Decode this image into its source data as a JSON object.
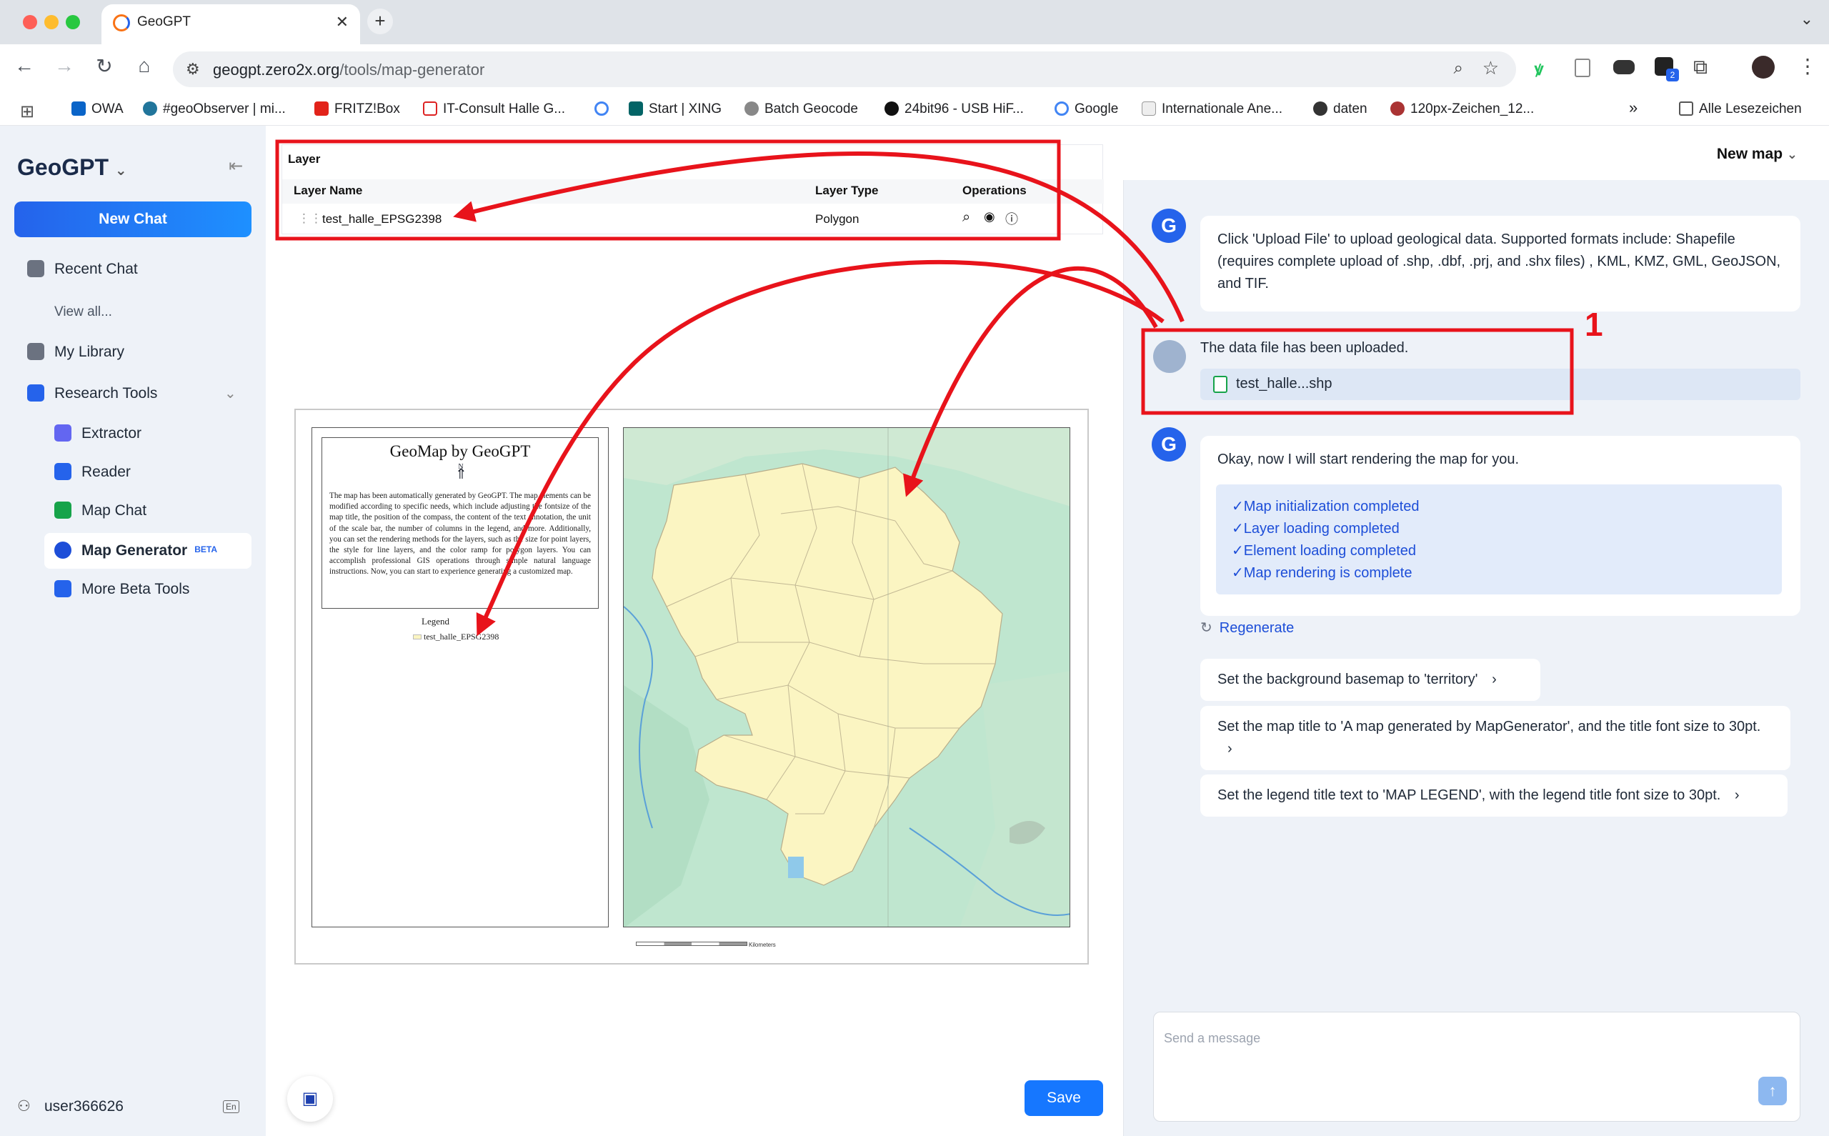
{
  "browser": {
    "tab_title": "GeoGPT",
    "url_host": "geogpt.zero2x.org",
    "url_path": "/tools/map-generator",
    "bookmarks": [
      "OWA",
      "#geoObserver | mi...",
      "FRITZ!Box",
      "IT-Consult Halle G...",
      "Start | XING",
      "Batch Geocode",
      "24bit96 - USB HiF...",
      "Google",
      "Internationale Ane...",
      "daten",
      "120px-Zeichen_12..."
    ],
    "all_bookmarks": "Alle Lesezeichen",
    "ext_badge": "2"
  },
  "sidebar": {
    "brand": "GeoGPT",
    "new_chat": "New Chat",
    "recent_chat": "Recent Chat",
    "view_all": "View all...",
    "my_library": "My Library",
    "research_tools": "Research Tools",
    "tools": [
      "Extractor",
      "Reader",
      "Map Chat",
      "Map Generator",
      "More Beta Tools"
    ],
    "beta_badge": "BETA",
    "user": "user366626",
    "lang": "En"
  },
  "layer_panel": {
    "title": "Layer",
    "col_name": "Layer Name",
    "col_type": "Layer Type",
    "col_ops": "Operations",
    "rows": [
      {
        "name": "test_halle_EPSG2398",
        "type": "Polygon"
      }
    ]
  },
  "map_layout": {
    "title": "GeoMap by GeoGPT",
    "north": "N",
    "description": "The map has been automatically generated by GeoGPT. The map elements can be modified according to specific needs, which include adjusting the fontsize of the map title, the position of the compass, the content of the text annotation, the unit of the scale bar, the number of columns in the legend, and more. Additionally, you can set the rendering methods for the layers, such as the size for point layers, the style for line layers, and the color ramp for polygon layers. You can accomplish professional GIS operations through simple natural language instructions. Now, you can start to experience generating a customized map.",
    "legend_title": "Legend",
    "legend_item": "test_halle_EPSG2398",
    "scale_unit": "Kilometers",
    "save": "Save"
  },
  "chat": {
    "header": "New map",
    "msg1": "Click 'Upload File' to upload geological data. Supported formats include: Shapefile (requires complete upload of .shp, .dbf, .prj, and .shx files) , KML, KMZ, GML, GeoJSON, and TIF.",
    "user_msg": "The data file has been uploaded.",
    "file_name": "test_halle...shp",
    "msg2": "Okay, now I will start rendering the map for you.",
    "checks": [
      "Map initialization completed",
      "Layer loading completed",
      "Element loading completed",
      "Map rendering is complete"
    ],
    "regenerate": "Regenerate",
    "suggestions": [
      "Set the background basemap to 'territory'",
      "Set the map title to 'A map generated by MapGenerator', and the title font size to 30pt.",
      "Set the legend title text to 'MAP LEGEND', with the legend title font size to 30pt."
    ],
    "input_placeholder": "Send a message"
  },
  "annotation": {
    "label": "1",
    "color": "#e8131b"
  }
}
